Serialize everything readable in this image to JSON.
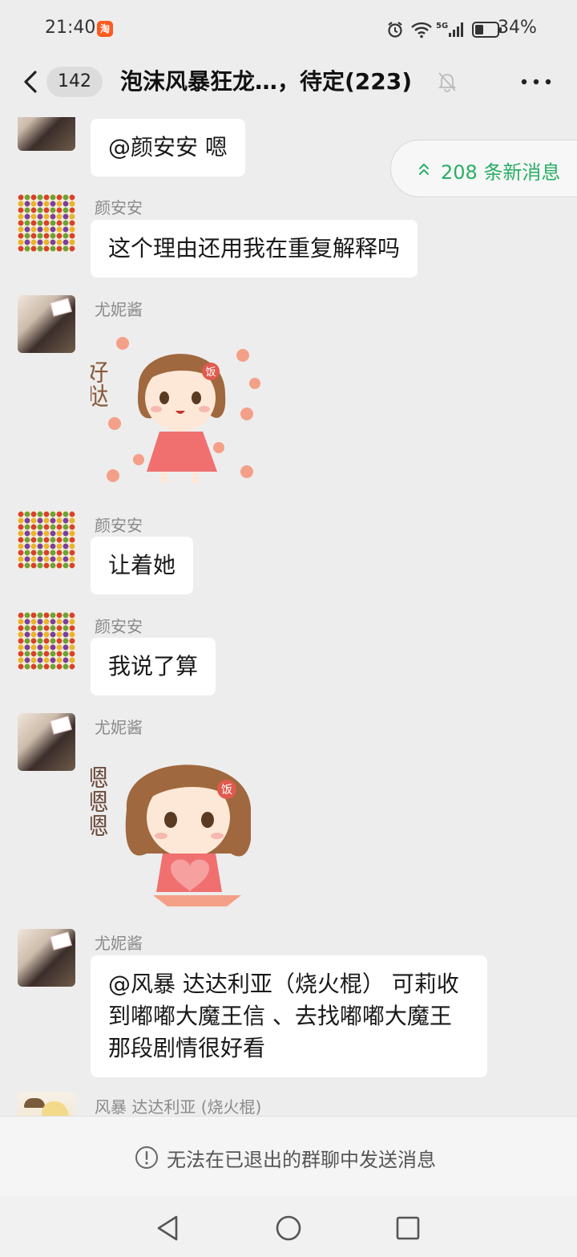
{
  "status_bar": {
    "time": "21:40",
    "app_badge": "淘",
    "network": "5G",
    "battery_percent": "34%"
  },
  "nav": {
    "unread_count": "142",
    "title": "泡沫风暴狂龙…，待定(223)"
  },
  "new_messages": {
    "label": "208 条新消息"
  },
  "messages": [
    {
      "text": "@颜安安  嗯"
    },
    {
      "sender": "颜安安",
      "text": "这个理由还用我在重复解释吗"
    },
    {
      "sender": "尤妮酱",
      "sticker_text": "好哒",
      "sticker_badge": "饭"
    },
    {
      "sender": "颜安安",
      "text": "让着她"
    },
    {
      "sender": "颜安安",
      "text": "我说了算"
    },
    {
      "sender": "尤妮酱",
      "sticker_text": "嗯嗯嗯",
      "sticker_badge": "饭"
    },
    {
      "sender": "尤妮酱",
      "text": "@风暴 达达利亚（烧火棍） 可莉收到嘟嘟大魔王信 、去找嘟嘟大魔王 那段剧情很好看"
    },
    {
      "sender": "风暴 达达利亚 (烧火棍)"
    }
  ],
  "footer": {
    "notice": "无法在已退出的群聊中发送消息"
  },
  "colors": {
    "background": "#ededed",
    "bubble": "#ffffff",
    "accent_green": "#2aae67",
    "sticker_dress": "#f07070",
    "sticker_hair": "#a0683e"
  },
  "icons": [
    "back-arrow-icon",
    "mute-bell-icon",
    "more-dots-icon",
    "double-chevron-up-icon",
    "info-circle-icon",
    "nav-back-triangle-icon",
    "nav-home-circle-icon",
    "nav-recents-square-icon"
  ]
}
